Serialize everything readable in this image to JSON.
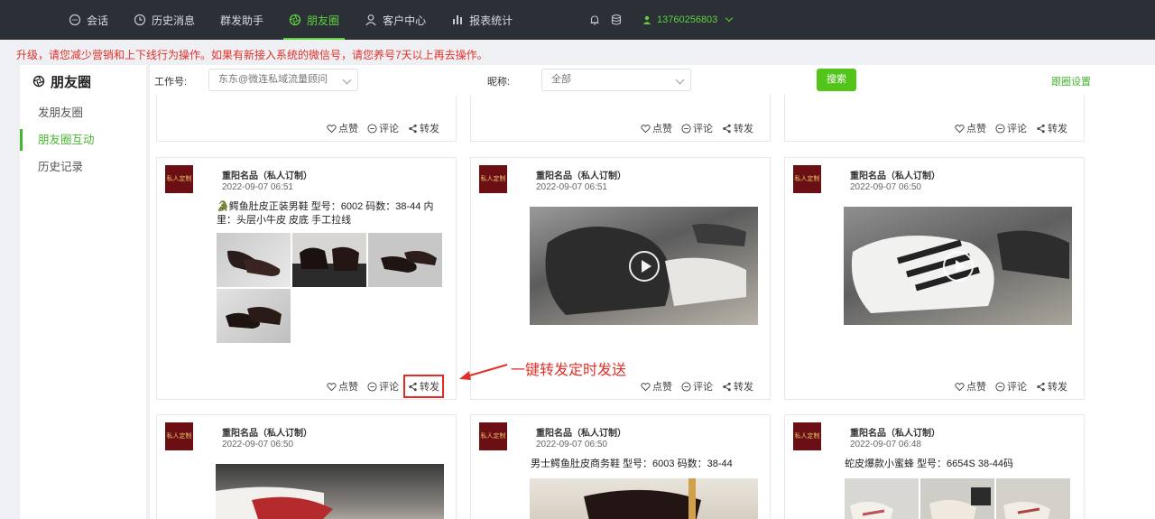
{
  "nav": {
    "items": [
      {
        "label": "会话",
        "icon": "chat-icon"
      },
      {
        "label": "历史消息",
        "icon": "clock-icon"
      },
      {
        "label": "群发助手",
        "icon": ""
      },
      {
        "label": "朋友圈",
        "icon": "moments-icon"
      },
      {
        "label": "客户中心",
        "icon": "user-icon"
      },
      {
        "label": "报表统计",
        "icon": "bar-chart-icon"
      }
    ],
    "active_index": 3,
    "phone": "13760256803",
    "accent": "#5ed13d"
  },
  "notice": "升级，请您减少营销和上下线行为操作。如果有新接入系统的微信号，请您养号7天以上再去操作。",
  "sidebar": {
    "title": "朋友圈",
    "items": [
      "发朋友圈",
      "朋友圈互动",
      "历史记录"
    ],
    "active_index": 1
  },
  "filter": {
    "account_label": "工作号:",
    "account_value": "东东@微连私域流量顾问",
    "nickname_label": "昵称:",
    "nickname_value": "全部",
    "search_label": "搜索",
    "settings_label": "跟圈设置"
  },
  "actions": {
    "like": "点赞",
    "comment": "评论",
    "forward": "转发"
  },
  "posts": [
    {
      "author": "重阳名品（私人订制）",
      "time": "2022-09-07 06:51",
      "text": "🐊鳄鱼肚皮正装男鞋 型号：6002 码数：38-44 内里：头层小牛皮 皮底 手工拉线",
      "media": "images"
    },
    {
      "author": "重阳名品（私人订制）",
      "time": "2022-09-07 06:51",
      "text": "",
      "media": "video"
    },
    {
      "author": "重阳名品（私人订制）",
      "time": "2022-09-07 06:50",
      "text": "",
      "media": "video"
    },
    {
      "author": "重阳名品（私人订制）",
      "time": "2022-09-07 06:50",
      "text": "",
      "media": "image"
    },
    {
      "author": "重阳名品（私人订制）",
      "time": "2022-09-07 06:50",
      "text": "男士鳄鱼肚皮商务鞋 型号：6003 码数：38-44",
      "media": "image"
    },
    {
      "author": "重阳名品（私人订制）",
      "time": "2022-09-07 06:48",
      "text": "蛇皮爆款小蜜蜂 型号：6654S 38-44码",
      "media": "images"
    }
  ],
  "avatar_text": "私人定制",
  "annotation": "一键转发定时发送"
}
